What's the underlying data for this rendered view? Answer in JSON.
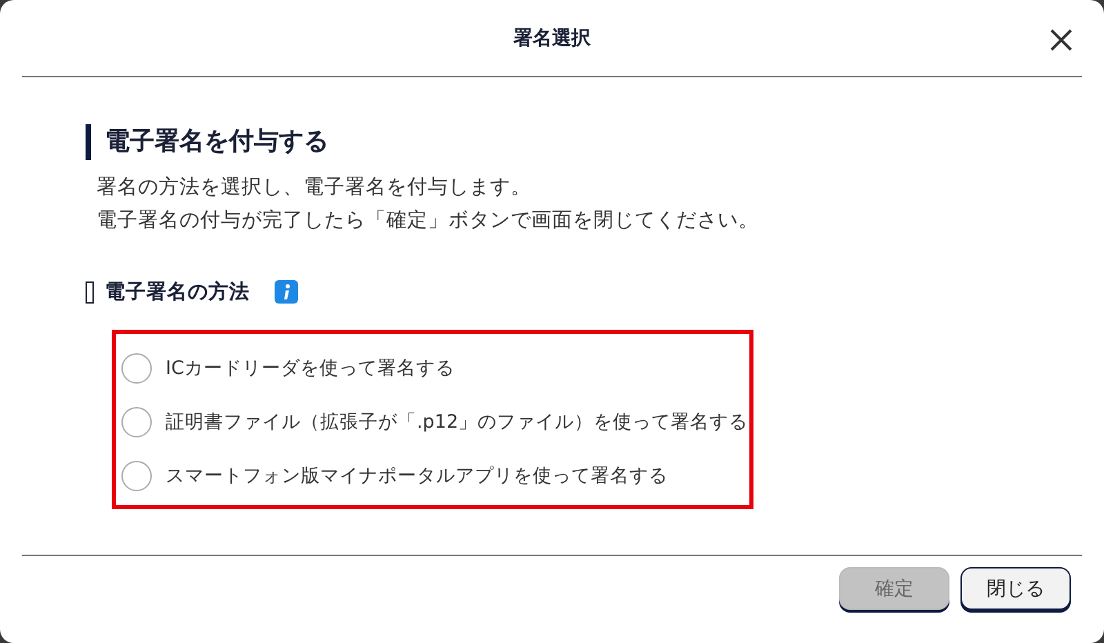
{
  "dialog": {
    "title": "署名選択"
  },
  "heading": "電子署名を付与する",
  "description": [
    "署名の方法を選択し、電子署名を付与します。",
    "電子署名の付与が完了したら「確定」ボタンで画面を閉じてください。"
  ],
  "method_section": {
    "title": "電子署名の方法",
    "options": [
      {
        "label": "ICカードリーダを使って署名する",
        "selected": false
      },
      {
        "label": "証明書ファイル（拡張子が「.p12」のファイル）を使って署名する",
        "selected": false
      },
      {
        "label": "スマートフォン版マイナポータルアプリを使って署名する",
        "selected": false
      }
    ]
  },
  "buttons": [
    {
      "label": "確定",
      "disabled": true
    },
    {
      "label": "閉じる",
      "disabled": false
    }
  ]
}
